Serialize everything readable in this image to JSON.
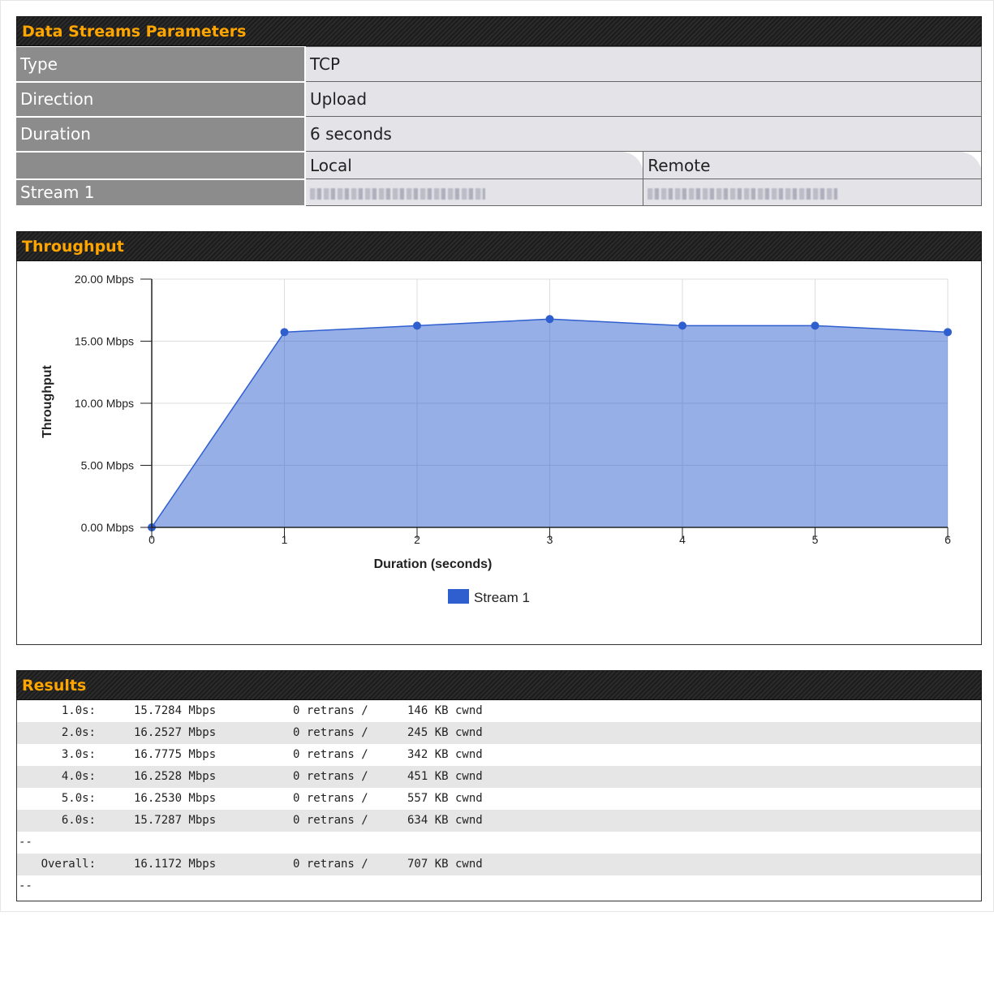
{
  "params": {
    "title": "Data Streams Parameters",
    "rows": [
      {
        "label": "Type",
        "value": "TCP"
      },
      {
        "label": "Direction",
        "value": "Upload"
      },
      {
        "label": "Duration",
        "value": "6 seconds"
      }
    ],
    "columns": {
      "local": "Local",
      "remote": "Remote"
    },
    "stream": {
      "label": "Stream 1"
    }
  },
  "throughput": {
    "title": "Throughput",
    "chart_data": {
      "type": "area",
      "title": "",
      "xlabel": "Duration (seconds)",
      "ylabel": "Throughput",
      "x": [
        0,
        1,
        2,
        3,
        4,
        5,
        6
      ],
      "xlim": [
        0,
        6
      ],
      "ylim": [
        0,
        20
      ],
      "yticks": [
        "0.00 Mbps",
        "5.00 Mbps",
        "10.00 Mbps",
        "15.00 Mbps",
        "20.00 Mbps"
      ],
      "xticks": [
        "0",
        "1",
        "2",
        "3",
        "4",
        "5",
        "6"
      ],
      "series": [
        {
          "name": "Stream 1",
          "values": [
            0,
            15.73,
            16.25,
            16.78,
            16.25,
            16.25,
            15.73
          ],
          "color": "#2f5fcf"
        }
      ],
      "grid": true,
      "legend": "bottom-center"
    }
  },
  "results": {
    "title": "Results",
    "rows": [
      {
        "time": "1.0s:",
        "rate": "15.7284 Mbps",
        "retrans": "0 retrans /",
        "cwnd": "146 KB cwnd"
      },
      {
        "time": "2.0s:",
        "rate": "16.2527 Mbps",
        "retrans": "0 retrans /",
        "cwnd": "245 KB cwnd"
      },
      {
        "time": "3.0s:",
        "rate": "16.7775 Mbps",
        "retrans": "0 retrans /",
        "cwnd": "342 KB cwnd"
      },
      {
        "time": "4.0s:",
        "rate": "16.2528 Mbps",
        "retrans": "0 retrans /",
        "cwnd": "451 KB cwnd"
      },
      {
        "time": "5.0s:",
        "rate": "16.2530 Mbps",
        "retrans": "0 retrans /",
        "cwnd": "557 KB cwnd"
      },
      {
        "time": "6.0s:",
        "rate": "15.7287 Mbps",
        "retrans": "0 retrans /",
        "cwnd": "634 KB cwnd"
      }
    ],
    "separator": "--",
    "overall": {
      "time": "Overall:",
      "rate": "16.1172 Mbps",
      "retrans": "0 retrans /",
      "cwnd": "707 KB cwnd"
    },
    "end_separator": "--"
  }
}
